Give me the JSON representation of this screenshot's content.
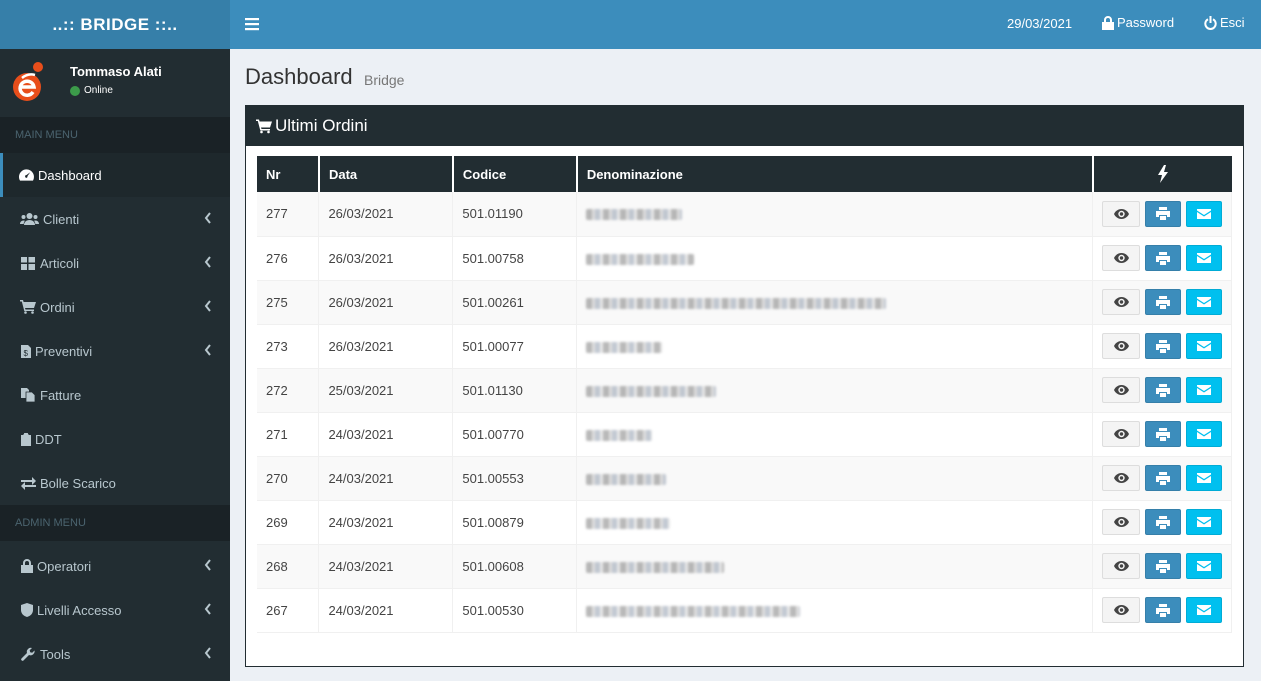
{
  "app": {
    "brand": "..:: BRIDGE ::.."
  },
  "user": {
    "name": "Tommaso Alati",
    "status": "Online"
  },
  "menus": {
    "main_header": "MAIN MENU",
    "admin_header": "ADMIN MENU",
    "main": [
      {
        "label": "Dashboard",
        "icon": "dashboard-icon"
      },
      {
        "label": "Clienti",
        "icon": "users-icon"
      },
      {
        "label": "Articoli",
        "icon": "th-large-icon"
      },
      {
        "label": "Ordini",
        "icon": "cart-icon"
      },
      {
        "label": "Preventivi",
        "icon": "file-dollar-icon"
      },
      {
        "label": "Fatture",
        "icon": "files-icon"
      },
      {
        "label": "DDT",
        "icon": "clipboard-icon"
      },
      {
        "label": "Bolle Scarico",
        "icon": "exchange-icon"
      }
    ],
    "admin": [
      {
        "label": "Operatori",
        "icon": "lock-icon"
      },
      {
        "label": "Livelli Accesso",
        "icon": "shield-icon"
      },
      {
        "label": "Tools",
        "icon": "wrench-icon"
      }
    ]
  },
  "topbar": {
    "date": "29/03/2021",
    "password": "Password",
    "exit": "Esci"
  },
  "page": {
    "title": "Dashboard",
    "subtitle": "Bridge"
  },
  "panel": {
    "title": "Ultimi Ordini",
    "columns": [
      "Nr",
      "Data",
      "Codice",
      "Denominazione"
    ],
    "rows": [
      {
        "nr": "277",
        "data": "26/03/2021",
        "codice": "501.01190"
      },
      {
        "nr": "276",
        "data": "26/03/2021",
        "codice": "501.00758"
      },
      {
        "nr": "275",
        "data": "26/03/2021",
        "codice": "501.00261"
      },
      {
        "nr": "273",
        "data": "26/03/2021",
        "codice": "501.00077"
      },
      {
        "nr": "272",
        "data": "25/03/2021",
        "codice": "501.01130"
      },
      {
        "nr": "271",
        "data": "24/03/2021",
        "codice": "501.00770"
      },
      {
        "nr": "270",
        "data": "24/03/2021",
        "codice": "501.00553"
      },
      {
        "nr": "269",
        "data": "24/03/2021",
        "codice": "501.00879"
      },
      {
        "nr": "268",
        "data": "24/03/2021",
        "codice": "501.00608"
      },
      {
        "nr": "267",
        "data": "24/03/2021",
        "codice": "501.00530"
      }
    ]
  },
  "colors": {
    "sidebar": "#222d32",
    "topbar": "#3c8dbc",
    "brand": "#367fa9",
    "print": "#3c8dbc",
    "mail": "#00c0ef"
  }
}
